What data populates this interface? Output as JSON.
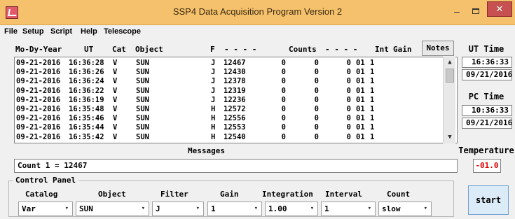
{
  "window": {
    "title": "SSP4 Data Acquisition Program Version 2",
    "minimize_glyph": "–",
    "close_glyph": "✕",
    "colors": {
      "titlebar": "#f5c16c",
      "close": "#c75050",
      "temperature": "#e00000"
    }
  },
  "menu": {
    "file": "File",
    "setup": "Setup",
    "script": "Script",
    "help": "Help",
    "telescope": "Telescope"
  },
  "headers": {
    "date": "Mo-Dy-Year",
    "ut": "UT",
    "cat": "Cat",
    "object": "Object",
    "filter": "F",
    "dashes1": "- - - -",
    "counts": "Counts",
    "dashes2": "- - - -",
    "int": "Int",
    "gain": "Gain",
    "notes_button": "Notes"
  },
  "rows": [
    {
      "date": "09-21-2016",
      "ut": "16:36:28",
      "cat": "V",
      "object": "SUN",
      "filter": "J",
      "c1": "12467",
      "c2": "0",
      "c3": "0",
      "c4": "0",
      "int": "01",
      "gain": "1"
    },
    {
      "date": "09-21-2016",
      "ut": "16:36:26",
      "cat": "V",
      "object": "SUN",
      "filter": "J",
      "c1": "12430",
      "c2": "0",
      "c3": "0",
      "c4": "0",
      "int": "01",
      "gain": "1"
    },
    {
      "date": "09-21-2016",
      "ut": "16:36:24",
      "cat": "V",
      "object": "SUN",
      "filter": "J",
      "c1": "12378",
      "c2": "0",
      "c3": "0",
      "c4": "0",
      "int": "01",
      "gain": "1"
    },
    {
      "date": "09-21-2016",
      "ut": "16:36:22",
      "cat": "V",
      "object": "SUN",
      "filter": "J",
      "c1": "12319",
      "c2": "0",
      "c3": "0",
      "c4": "0",
      "int": "01",
      "gain": "1"
    },
    {
      "date": "09-21-2016",
      "ut": "16:36:19",
      "cat": "V",
      "object": "SUN",
      "filter": "J",
      "c1": "12236",
      "c2": "0",
      "c3": "0",
      "c4": "0",
      "int": "01",
      "gain": "1"
    },
    {
      "date": "09-21-2016",
      "ut": "16:35:48",
      "cat": "V",
      "object": "SUN",
      "filter": "H",
      "c1": "12572",
      "c2": "0",
      "c3": "0",
      "c4": "0",
      "int": "01",
      "gain": "1"
    },
    {
      "date": "09-21-2016",
      "ut": "16:35:46",
      "cat": "V",
      "object": "SUN",
      "filter": "H",
      "c1": "12556",
      "c2": "0",
      "c3": "0",
      "c4": "0",
      "int": "01",
      "gain": "1"
    },
    {
      "date": "09-21-2016",
      "ut": "16:35:44",
      "cat": "V",
      "object": "SUN",
      "filter": "H",
      "c1": "12553",
      "c2": "0",
      "c3": "0",
      "c4": "0",
      "int": "01",
      "gain": "1"
    },
    {
      "date": "09-21-2016",
      "ut": "16:35:42",
      "cat": "V",
      "object": "SUN",
      "filter": "H",
      "c1": "12540",
      "c2": "0",
      "c3": "0",
      "c4": "0",
      "int": "01",
      "gain": "1"
    }
  ],
  "scroll": {
    "up": "▲",
    "down": "▼"
  },
  "ut_time": {
    "label": "UT Time",
    "time": "16:36:33",
    "date": "09/21/2016"
  },
  "pc_time": {
    "label": "PC Time",
    "time": "10:36:33",
    "date": "09/21/2016"
  },
  "messages": {
    "label": "Messages",
    "text": "Count 1 = 12467"
  },
  "temperature": {
    "label": "Temperature",
    "value": "-01.0"
  },
  "control_panel": {
    "title": "Control Panel",
    "catalog": {
      "label": "Catalog",
      "value": "Var"
    },
    "object": {
      "label": "Object",
      "value": "SUN"
    },
    "filter": {
      "label": "Filter",
      "value": "J"
    },
    "gain": {
      "label": "Gain",
      "value": "1"
    },
    "integration": {
      "label": "Integration",
      "value": "1.00"
    },
    "interval": {
      "label": "Interval",
      "value": "1"
    },
    "count": {
      "label": "Count",
      "value": "slow"
    },
    "chevron": "▾",
    "start_button": "start"
  }
}
